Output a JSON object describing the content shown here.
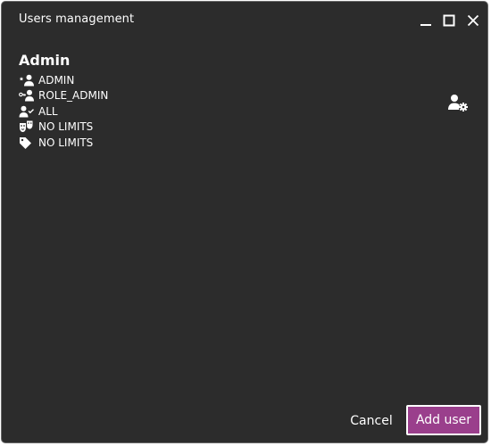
{
  "window": {
    "title": "Users management",
    "controls": [
      "minimize-icon",
      "maximize-icon",
      "close-icon"
    ]
  },
  "user": {
    "name": "Admin",
    "attributes": [
      {
        "icon": "user-star-icon",
        "value": "ADMIN"
      },
      {
        "icon": "user-key-icon",
        "value": "ROLE_ADMIN"
      },
      {
        "icon": "user-check-icon",
        "value": "ALL"
      },
      {
        "icon": "theater-masks-icon",
        "value": "NO LIMITS"
      },
      {
        "icon": "tag-icon",
        "value": "NO LIMITS"
      }
    ],
    "settings_icon": "user-gear-icon"
  },
  "footer": {
    "cancel_label": "Cancel",
    "add_label": "Add user"
  },
  "colors": {
    "background": "#2c2c2c",
    "accent": "#9a3f8c",
    "text": "#ffffff"
  }
}
